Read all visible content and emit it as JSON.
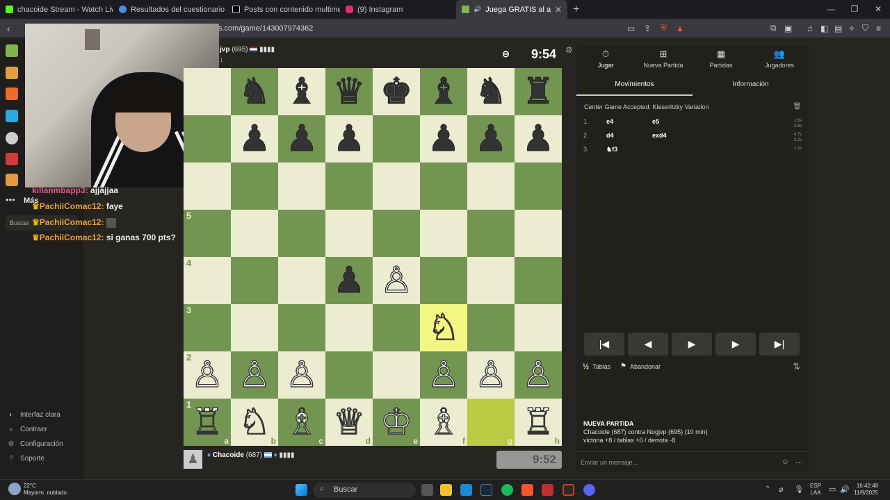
{
  "tabs": [
    {
      "title": "chacoide Stream - Watch Live on",
      "color": "#53fc18"
    },
    {
      "title": "Resultados del cuestionario ¿eres un",
      "color": "#4a8fe7"
    },
    {
      "title": "Posts con contenido multimedia de",
      "color": "#ffffff"
    },
    {
      "title": "(9) Instagram",
      "color": "#e1306c"
    },
    {
      "title": "Juega GRATIS al ajedrez online",
      "color": "#81b64c"
    }
  ],
  "address": {
    "url": "s.com/game/143007974362"
  },
  "sidebar": {
    "more_label": "Más",
    "search_label": "Buscar",
    "bottom": [
      {
        "icon": "◐",
        "label": "Interfaz clara"
      },
      {
        "icon": "«",
        "label": "Contraer"
      },
      {
        "icon": "⚙",
        "label": "Configuración"
      },
      {
        "icon": "?",
        "label": "Soporte"
      }
    ]
  },
  "chat": [
    {
      "user": "killanmbapp3:",
      "text": "ajjajjaa"
    },
    {
      "user": "PachiiComac12:",
      "text": "faye"
    },
    {
      "user": "PachiiComac12:",
      "text": ""
    },
    {
      "user": "PachiiComac12:",
      "text": "si ganas 700 pts?"
    }
  ],
  "opponent": {
    "name": "jvp",
    "rating": "(695)",
    "clock": "9:54",
    "rank_digit": "1"
  },
  "player": {
    "name": "Chacoide",
    "rating": "(687)",
    "clock": "9:52"
  },
  "board": {
    "rows": [
      [
        "",
        "♞",
        "♝",
        "♛",
        "♚",
        "♝",
        "♞",
        "♜"
      ],
      [
        "",
        "♟",
        "♟",
        "♟",
        "",
        "♟",
        "♟",
        "♟"
      ],
      [
        "",
        "",
        "",
        "",
        "",
        "",
        "",
        ""
      ],
      [
        "",
        "",
        "",
        "",
        "",
        "",
        "",
        ""
      ],
      [
        "",
        "",
        "",
        "♟",
        "♙",
        "",
        "",
        ""
      ],
      [
        "",
        "",
        "",
        "",
        "",
        "♘",
        "",
        ""
      ],
      [
        "♙",
        "♙",
        "♙",
        "",
        "",
        "♙",
        "♙",
        "♙"
      ],
      [
        "♖",
        "♘",
        "♗",
        "♕",
        "♔",
        "♗",
        "",
        "♖"
      ]
    ],
    "colors": [
      [
        "",
        "b",
        "b",
        "b",
        "b",
        "b",
        "b",
        "b"
      ],
      [
        "",
        "b",
        "b",
        "b",
        "",
        "b",
        "b",
        "b"
      ],
      [
        "",
        "",
        "",
        "",
        "",
        "",
        "",
        ""
      ],
      [
        "",
        "",
        "",
        "",
        "",
        "",
        "",
        ""
      ],
      [
        "",
        "",
        "",
        "b",
        "w",
        "",
        "",
        ""
      ],
      [
        "",
        "",
        "",
        "",
        "",
        "w",
        "",
        ""
      ],
      [
        "w",
        "w",
        "w",
        "",
        "",
        "w",
        "w",
        "w"
      ],
      [
        "w",
        "w",
        "w",
        "w",
        "w",
        "w",
        "",
        "w"
      ]
    ],
    "ranks": [
      "",
      "",
      "",
      "5",
      "4",
      "3",
      "2",
      "1"
    ],
    "files": [
      "a",
      "b",
      "c",
      "d",
      "e",
      "f",
      "g",
      "h"
    ],
    "highlight_from": "g1",
    "highlight_to": "f3"
  },
  "panel": {
    "tabs": [
      {
        "icon": "⏱",
        "label": "Jugar"
      },
      {
        "icon": "⊞",
        "label": "Nueva Partida"
      },
      {
        "icon": "▦",
        "label": "Partidas"
      },
      {
        "icon": "👥",
        "label": "Jugadores"
      }
    ],
    "subtabs": [
      "Movimientos",
      "Información"
    ],
    "opening": "Center Game Accepted: Kieseritzky Variation",
    "moves": [
      {
        "n": "1.",
        "w": "e4",
        "b": "e5",
        "tw": "1.6s",
        "tb": "2.8s"
      },
      {
        "n": "2.",
        "w": "d4",
        "b": "exd4",
        "tw": "4.7s",
        "tb": "2.2s"
      },
      {
        "n": "3.",
        "w": "♞f3",
        "b": "",
        "tw": "1.2s",
        "tb": ""
      }
    ],
    "nav": [
      "|◀",
      "◀",
      "▶",
      "▶",
      "▶|"
    ],
    "draw_label": "Tablas",
    "resign_label": "Abandonar",
    "draw_icon": "½",
    "new_game_title": "NUEVA PARTIDA",
    "new_game_players": "Chacoide (687) contra Nogjvp (695) (10 min)",
    "new_game_result": "victoria +8 / tablas +0 / derrota -8",
    "message_placeholder": "Enviar un mensaje..."
  },
  "taskbar": {
    "weather_temp": "22°C",
    "weather_desc": "Mayorm. nublado",
    "search_label": "Buscar",
    "lang1": "ESP",
    "lang2": "LAA",
    "time": "16:42:48",
    "date": "11/9/2025"
  }
}
